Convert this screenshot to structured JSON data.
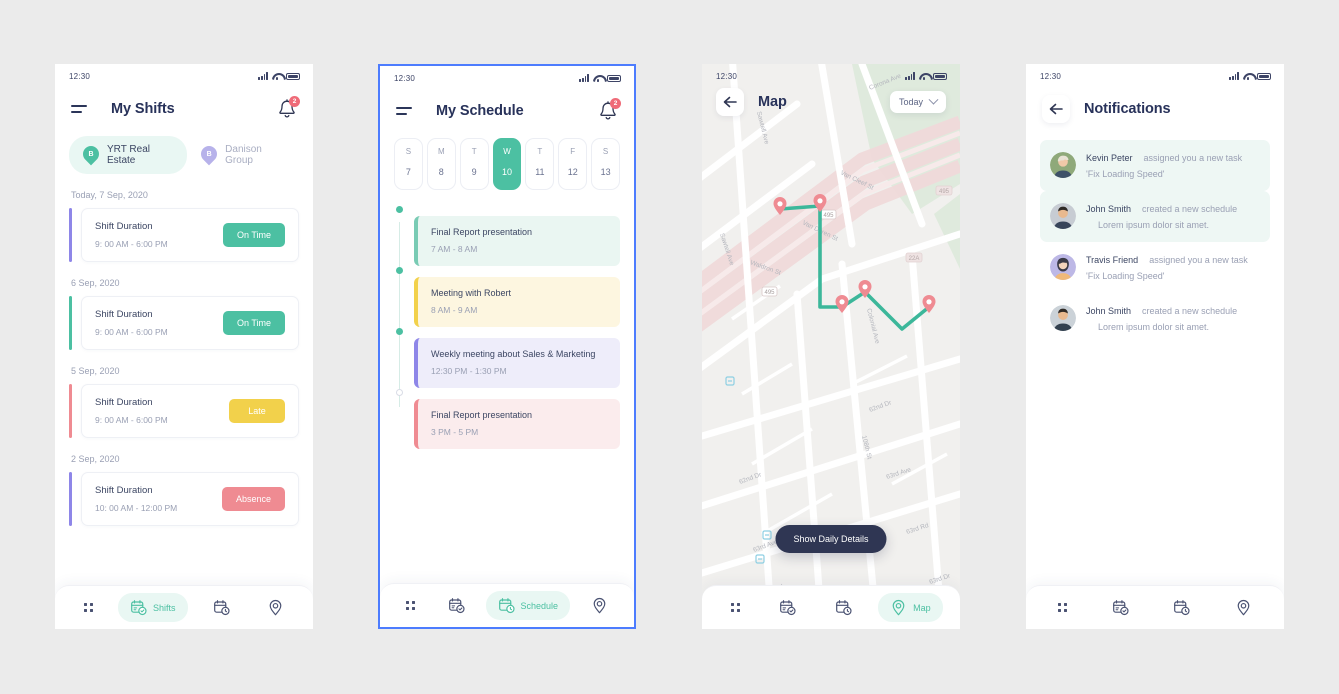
{
  "status_bar": {
    "time": "12:30",
    "signal_icon": "signal-bars-icon",
    "wifi_icon": "wifi-icon",
    "battery_icon": "battery-icon"
  },
  "colors": {
    "teal": "#4cc0a2",
    "teal_soft": "#e9f7f3",
    "yellow": "#f2d14b",
    "red": "#ef8b92",
    "purple": "#8e86e8",
    "navy": "#2f3653",
    "muted": "#9aa0b4"
  },
  "phone_shifts": {
    "title": "My Shifts",
    "menu_icon": "hamburger-menu-icon",
    "bell_icon": "bell-icon",
    "bell_badge": "2",
    "company_tabs": [
      {
        "label": "YRT Real Estate",
        "avatar_letter": "B",
        "active": true
      },
      {
        "label": "Danison Group",
        "avatar_letter": "B",
        "active": false
      }
    ],
    "groups": [
      {
        "date_label": "Today, 7 Sep, 2020",
        "shifts": [
          {
            "title": "Shift Duration",
            "time": "9: 00 AM - 6:00 PM",
            "status": "On Time",
            "status_color": "#4cc0a2",
            "accent": "#8e86e8"
          }
        ]
      },
      {
        "date_label": "6 Sep, 2020",
        "shifts": [
          {
            "title": "Shift Duration",
            "time": "9: 00 AM - 6:00 PM",
            "status": "On Time",
            "status_color": "#4cc0a2",
            "accent": "#4cc0a2"
          }
        ]
      },
      {
        "date_label": "5 Sep, 2020",
        "shifts": [
          {
            "title": "Shift Duration",
            "time": "9: 00 AM - 6:00 PM",
            "status": "Late",
            "status_color": "#f2d14b",
            "accent": "#ef8b92"
          }
        ]
      },
      {
        "date_label": "2 Sep, 2020",
        "shifts": [
          {
            "title": "Shift Duration",
            "time": "10: 00 AM - 12:00 PM",
            "status": "Absence",
            "status_color": "#ef8b92",
            "accent": "#8e86e8"
          }
        ]
      }
    ],
    "nav": [
      {
        "icon": "grid-dots-icon",
        "label": "",
        "active": false
      },
      {
        "icon": "shifts-calendar-check-icon",
        "label": "Shifts",
        "active": true
      },
      {
        "icon": "calendar-clock-icon",
        "label": "",
        "active": false
      },
      {
        "icon": "location-pin-icon",
        "label": "",
        "active": false
      }
    ]
  },
  "phone_schedule": {
    "title": "My Schedule",
    "menu_icon": "hamburger-menu-icon",
    "bell_icon": "bell-icon",
    "bell_badge": "2",
    "days": [
      {
        "dow": "S",
        "num": "7",
        "selected": false
      },
      {
        "dow": "M",
        "num": "8",
        "selected": false
      },
      {
        "dow": "T",
        "num": "9",
        "selected": false
      },
      {
        "dow": "W",
        "num": "10",
        "selected": true
      },
      {
        "dow": "T",
        "num": "11",
        "selected": false
      },
      {
        "dow": "F",
        "num": "12",
        "selected": false
      },
      {
        "dow": "S",
        "num": "13",
        "selected": false
      }
    ],
    "events": [
      {
        "title": "Final Report presentation",
        "time": "7 AM - 8 AM",
        "bar": "#79cbb4",
        "bg": "#eaf6f2",
        "dot": "filled"
      },
      {
        "title": "Meeting with Robert",
        "time": "8 AM - 9 AM",
        "bar": "#f2d14b",
        "bg": "#fdf6e0",
        "dot": "filled"
      },
      {
        "title": "Weekly meeting about Sales & Marketing",
        "time": "12:30 PM - 1:30 PM",
        "bar": "#8e86e8",
        "bg": "#eeedfa",
        "dot": "filled"
      },
      {
        "title": "Final Report presentation",
        "time": "3 PM - 5 PM",
        "bar": "#ef8b92",
        "bg": "#fbeced",
        "dot": "hollow"
      }
    ],
    "nav": [
      {
        "icon": "grid-dots-icon",
        "label": "",
        "active": false
      },
      {
        "icon": "shifts-calendar-check-icon",
        "label": "",
        "active": false
      },
      {
        "icon": "calendar-clock-icon",
        "label": "Schedule",
        "active": true
      },
      {
        "icon": "location-pin-icon",
        "label": "",
        "active": false
      }
    ]
  },
  "phone_map": {
    "title": "Map",
    "back_icon": "back-arrow-icon",
    "filter_label": "Today",
    "filter_chevron_icon": "chevron-down-icon",
    "cta_label": "Show Daily Details",
    "street_labels": [
      "Corona Ave",
      "Van Cleef St",
      "Van Doren St",
      "Waldron St",
      "Sawtell Ave",
      "Colonial Ave",
      "63rd Dr",
      "63rd Ave",
      "63rd Rd",
      "62nd Dr",
      "108th St",
      "64th Rd"
    ],
    "highway_shields": [
      "495",
      "495",
      "22A",
      "22A"
    ],
    "route_stops": 6,
    "nav": [
      {
        "icon": "grid-dots-icon",
        "label": "",
        "active": false
      },
      {
        "icon": "shifts-calendar-check-icon",
        "label": "",
        "active": false
      },
      {
        "icon": "calendar-clock-icon",
        "label": "",
        "active": false
      },
      {
        "icon": "location-pin-icon",
        "label": "Map",
        "active": true
      }
    ]
  },
  "phone_notifications": {
    "title": "Notifications",
    "back_icon": "back-arrow-icon",
    "items": [
      {
        "name": "Kevin Peter",
        "action": "assigned you a new task",
        "detail": "'Fix Loading Speed'",
        "highlight": true,
        "indent": false,
        "avatar": "avatar-kevin-peter"
      },
      {
        "name": "John Smith",
        "action": "created a new schedule",
        "detail": "Lorem ipsum dolor sit amet.",
        "highlight": true,
        "indent": true,
        "avatar": "avatar-john-smith"
      },
      {
        "name": "Travis Friend",
        "action": "assigned you a new task",
        "detail": "'Fix Loading Speed'",
        "highlight": false,
        "indent": false,
        "avatar": "avatar-travis-friend"
      },
      {
        "name": "John Smith",
        "action": "created a new schedule",
        "detail": "Lorem ipsum dolor sit amet.",
        "highlight": false,
        "indent": true,
        "avatar": "avatar-john-smith-2"
      }
    ],
    "nav": [
      {
        "icon": "grid-dots-icon",
        "label": "",
        "active": false
      },
      {
        "icon": "shifts-calendar-check-icon",
        "label": "",
        "active": false
      },
      {
        "icon": "calendar-clock-icon",
        "label": "",
        "active": false
      },
      {
        "icon": "location-pin-icon",
        "label": "",
        "active": false
      }
    ]
  }
}
